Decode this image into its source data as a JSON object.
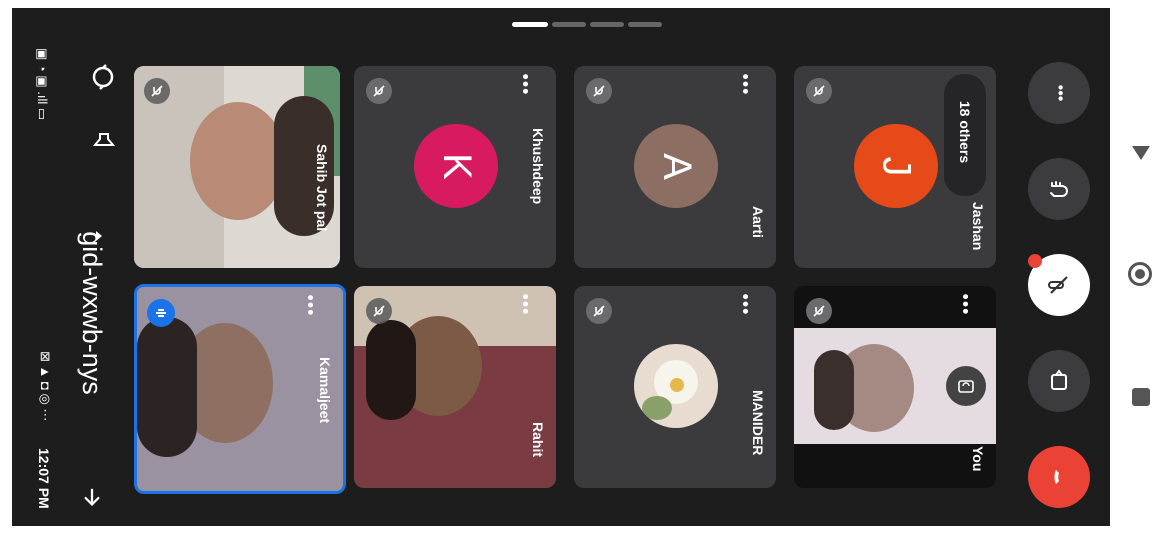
{
  "status_bar": {
    "time": "12:07 PM",
    "notification_icons": "⊠ ▲ ◘ ◎ ⋯",
    "system_icons": "▣ ◔ ▣ .ıll ▭"
  },
  "header": {
    "meeting_code": "gid-wxwb-nys"
  },
  "participants": {
    "sahib": {
      "name": "Sahib Jot pal"
    },
    "kamaljeet": {
      "name": "Kamaljeet"
    },
    "khushdeep": {
      "name": "Khushdeep",
      "initial": "K",
      "color": "#d81b60"
    },
    "rahit": {
      "name": "Rahit"
    },
    "aarti": {
      "name": "Aarti",
      "initial": "A",
      "color": "#8d6e63"
    },
    "manider": {
      "name": "MANIDER"
    },
    "jashan": {
      "name": "Jashan",
      "initial": "J",
      "color": "#e64a19",
      "others_label": "18 others"
    },
    "you": {
      "name": "You"
    }
  },
  "more_label": "•••",
  "colors": {
    "accent_blue": "#1a73e8",
    "end_call_red": "#ea4335"
  }
}
